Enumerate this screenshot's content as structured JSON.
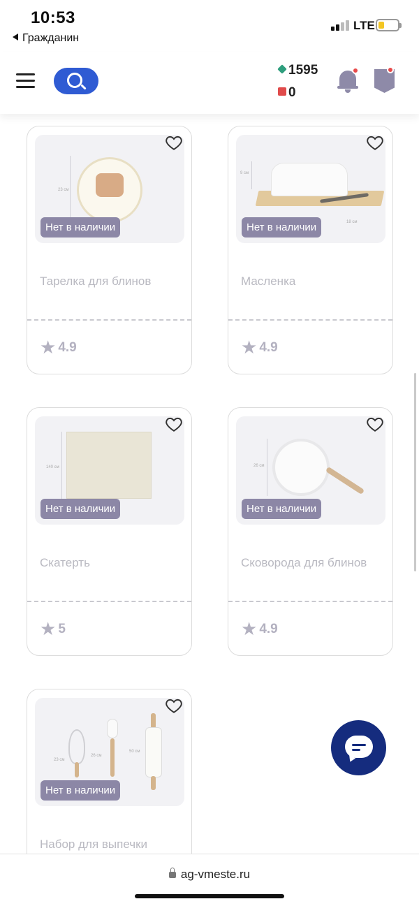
{
  "status_bar": {
    "time": "10:53",
    "back_label": "Гражданин",
    "network": "LTE"
  },
  "header": {
    "balance_primary": "1595",
    "balance_secondary": "0"
  },
  "products": [
    {
      "name": "Тарелка для блинов",
      "badge": "Нет в наличии",
      "rating": "4.9",
      "image": "plate",
      "dims": [
        "23 см"
      ]
    },
    {
      "name": "Масленка",
      "badge": "Нет в наличии",
      "rating": "4.9",
      "image": "butter-dish",
      "dims": [
        "9 см",
        "18 см"
      ]
    },
    {
      "name": "Скатерть",
      "badge": "Нет в наличии",
      "rating": "5",
      "image": "tablecloth",
      "dims": [
        "140 см"
      ]
    },
    {
      "name": "Сковорода для блинов",
      "badge": "Нет в наличии",
      "rating": "4.9",
      "image": "pan",
      "dims": [
        "26 см"
      ]
    },
    {
      "name": "Набор для выпечки",
      "badge": "Нет в наличии",
      "rating": "",
      "image": "baking-set",
      "dims": [
        "23 см",
        "26 см",
        "50 см"
      ]
    }
  ],
  "browser": {
    "url": "ag-vmeste.ru"
  },
  "colors": {
    "accent": "#2f5bd3",
    "chat": "#152c7e",
    "badge": "#8c87a6",
    "notification_dot": "#e84a4a"
  },
  "icons": [
    "search-icon",
    "menu-icon",
    "bell-icon",
    "shield-icon",
    "heart-icon",
    "star-icon",
    "chat-icon",
    "lock-icon"
  ]
}
